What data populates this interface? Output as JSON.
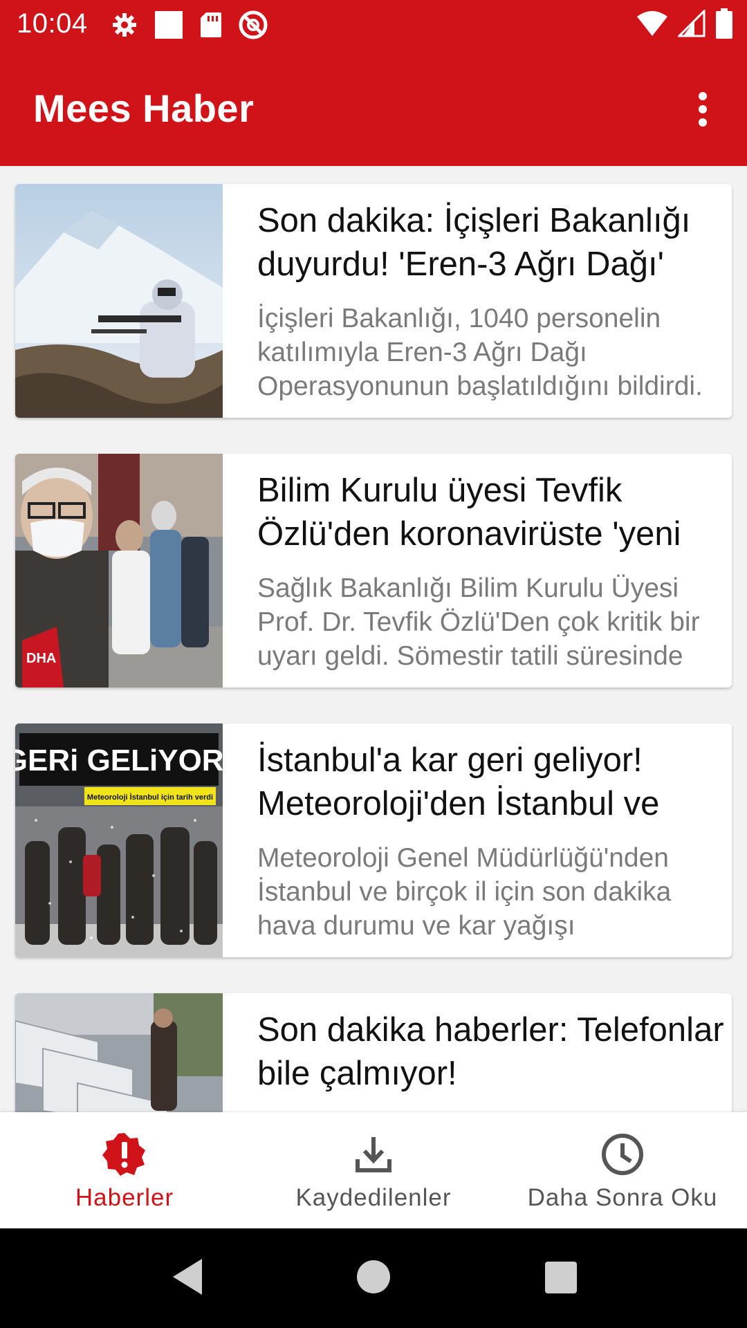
{
  "status_bar": {
    "time": "10:04",
    "left_icons": [
      "settings-icon",
      "square-icon",
      "sd-card-icon",
      "do-not-disturb-icon"
    ],
    "right_icons": [
      "wifi-icon",
      "cell-signal-icon",
      "battery-icon"
    ]
  },
  "app_bar": {
    "title": "Mees Haber",
    "menu_icon": "more-vert-icon"
  },
  "articles": [
    {
      "title": "Son dakika: İçişleri Bakanlığı duyurdu! 'Eren-3 Ağrı Dağı'",
      "summary": "İçişleri Bakanlığı, 1040 personelin katılımıyla Eren-3 Ağrı Dağı Operasyonunun başlatıldığını bildirdi."
    },
    {
      "title": "Bilim Kurulu üyesi Tevfik Özlü'den koronavirüste 'yeni",
      "summary": "Sağlık Bakanlığı Bilim Kurulu Üyesi Prof. Dr. Tevfik Özlü'Den çok kritik bir uyarı geldi. Sömestir tatili süresinde"
    },
    {
      "title": "İstanbul'a kar geri geliyor! Meteoroloji'den İstanbul ve",
      "summary": "Meteoroloji Genel Müdürlüğü'nden İstanbul ve birçok il için son dakika hava durumu ve kar yağışı",
      "thumb_headline": "GERi GELiYOR!",
      "thumb_subline": "Meteoroloji İstanbul için tarih verdi"
    },
    {
      "title": "Son dakika haberler: Telefonlar bile çalmıyor!",
      "summary": ""
    }
  ],
  "thumb_badge": "DHA",
  "bottom_nav": [
    {
      "label": "Haberler",
      "icon": "alert-badge-icon",
      "active": true
    },
    {
      "label": "Kaydedilenler",
      "icon": "download-icon",
      "active": false
    },
    {
      "label": "Daha Sonra Oku",
      "icon": "clock-icon",
      "active": false
    }
  ],
  "colors": {
    "brand_red": "#d01318",
    "title_text": "#111111",
    "summary_text": "#7a7a7a",
    "nav_inactive": "#555555"
  }
}
